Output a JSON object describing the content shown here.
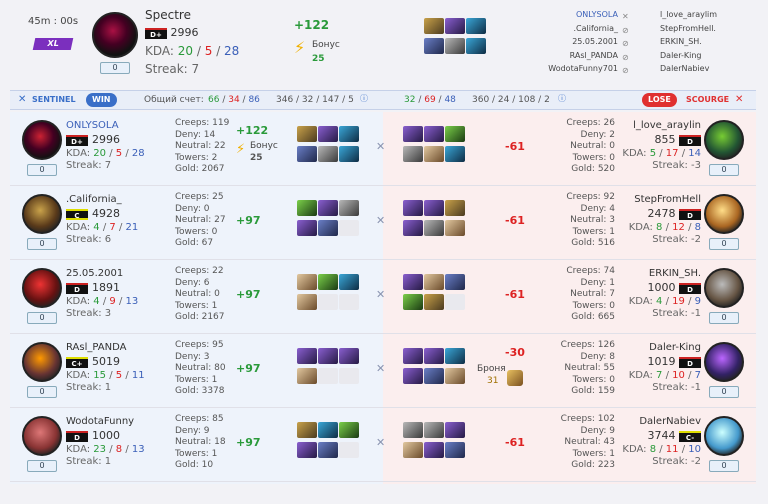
{
  "header": {
    "duration": "45m : 00s",
    "skill": "XL",
    "hero_level": "0",
    "hero_name": "Spectre",
    "rank": "D+",
    "mmr": "2996",
    "kda_label": "KDA:",
    "kda": [
      "20",
      "5",
      "28"
    ],
    "streak": "Streak: 7",
    "delta": "+122",
    "bonus_label": "Бонус",
    "bonus": "25",
    "mini_left": [
      ".California_",
      "25.05.2001",
      "RAsl_PANDA",
      "WodotaFunny701"
    ],
    "mini_left_top": "ONLYSOLA",
    "mini_right": [
      "l_love_araylim",
      "StepFromHell.",
      "ERKIN_SH.",
      "Daler-King",
      "DalerNabiev"
    ]
  },
  "bar": {
    "sentinel": "SENTINEL",
    "win": "WIN",
    "total_label": "Общий счет:",
    "left_kda": [
      "66",
      "34",
      "86"
    ],
    "left_stats": "346 / 32 / 147 / 5",
    "right_kda": [
      "32",
      "69",
      "48"
    ],
    "right_stats": "360 / 24 / 108 / 2",
    "lose": "LOSE",
    "scourge": "SCOURGE"
  },
  "left": [
    {
      "name": "ONLYSOLA",
      "rank": "D+",
      "mmr": "2996",
      "kda": [
        "20",
        "5",
        "28"
      ],
      "streak": "Streak: 7",
      "lvl": "0",
      "creeps": "Creeps: 119",
      "deny": "Deny: 14",
      "neutral": "Neutral: 22",
      "towers": "Towers: 2",
      "gold": "Gold: 2067",
      "delta": "+122",
      "bonus_label": "Бонус",
      "bonus": "25",
      "items": [
        "i1",
        "i6",
        "i3",
        "i2",
        "i5",
        "i3"
      ]
    },
    {
      "name": ".California_",
      "rank": "C",
      "mmr": "4928",
      "kda": [
        "4",
        "7",
        "21"
      ],
      "streak": "Streak: 6",
      "lvl": "0",
      "creeps": "Creeps: 25",
      "deny": "Deny: 0",
      "neutral": "Neutral: 27",
      "towers": "Towers: 0",
      "gold": "Gold: 67",
      "delta": "+97",
      "items": [
        "i4",
        "i6",
        "i5",
        "i6",
        "i2",
        "i0"
      ]
    },
    {
      "name": "25.05.2001",
      "rank": "D",
      "mmr": "1891",
      "kda": [
        "4",
        "9",
        "13"
      ],
      "streak": "Streak: 3",
      "lvl": "0",
      "creeps": "Creeps: 22",
      "deny": "Deny: 6",
      "neutral": "Neutral: 0",
      "towers": "Towers: 1",
      "gold": "Gold: 2167",
      "delta": "+97",
      "items": [
        "i7",
        "i4",
        "i3",
        "i7",
        "i0",
        "i0"
      ]
    },
    {
      "name": "RAsl_PANDA",
      "rank": "C+",
      "mmr": "5019",
      "kda": [
        "15",
        "5",
        "11"
      ],
      "streak": "Streak: 1",
      "lvl": "0",
      "creeps": "Creeps: 95",
      "deny": "Deny: 3",
      "neutral": "Neutral: 80",
      "towers": "Towers: 1",
      "gold": "Gold: 3378",
      "delta": "+97",
      "items": [
        "i6",
        "i6",
        "i6",
        "i7",
        "i0",
        "i0"
      ]
    },
    {
      "name": "WodotaFunny",
      "rank": "D",
      "mmr": "1000",
      "kda": [
        "23",
        "8",
        "13"
      ],
      "streak": "Streak: 1",
      "lvl": "0",
      "creeps": "Creeps: 85",
      "deny": "Deny: 9",
      "neutral": "Neutral: 18",
      "towers": "Towers: 1",
      "gold": "Gold: 10",
      "delta": "+97",
      "items": [
        "i1",
        "i3",
        "i4",
        "i6",
        "i2",
        "i0"
      ]
    }
  ],
  "right": [
    {
      "name": "l_love_araylin",
      "rank": "D",
      "mmr": "855",
      "kda": [
        "5",
        "17",
        "14"
      ],
      "streak": "Streak: -3",
      "lvl": "0",
      "creeps": "Creeps: 26",
      "deny": "Deny: 2",
      "neutral": "Neutral: 0",
      "towers": "Towers: 0",
      "gold": "Gold: 520",
      "delta": "-61",
      "items": [
        "i6",
        "i6",
        "i4",
        "i5",
        "i7",
        "i3"
      ]
    },
    {
      "name": "StepFromHell",
      "rank": "D",
      "mmr": "2478",
      "kda": [
        "8",
        "12",
        "8"
      ],
      "streak": "Streak: -2",
      "lvl": "0",
      "creeps": "Creeps: 92",
      "deny": "Deny: 4",
      "neutral": "Neutral: 3",
      "towers": "Towers: 1",
      "gold": "Gold: 516",
      "delta": "-61",
      "items": [
        "i6",
        "i6",
        "i1",
        "i6",
        "i5",
        "i7"
      ]
    },
    {
      "name": "ERKIN_SH.",
      "rank": "D",
      "mmr": "1000",
      "kda": [
        "4",
        "19",
        "9"
      ],
      "streak": "Streak: -1",
      "lvl": "0",
      "creeps": "Creeps: 74",
      "deny": "Deny: 1",
      "neutral": "Neutral: 7",
      "towers": "Towers: 0",
      "gold": "Gold: 665",
      "delta": "-61",
      "items": [
        "i6",
        "i7",
        "i2",
        "i4",
        "i1",
        "i0"
      ]
    },
    {
      "name": "Daler-King",
      "rank": "D",
      "mmr": "1019",
      "kda": [
        "7",
        "10",
        "7"
      ],
      "streak": "Streak: -1",
      "lvl": "0",
      "creeps": "Creeps: 126",
      "deny": "Deny: 8",
      "neutral": "Neutral: 55",
      "towers": "Towers: 0",
      "gold": "Gold: 159",
      "delta": "-30",
      "armor_label": "Броня",
      "armor": "31",
      "items": [
        "i6",
        "i6",
        "i3",
        "i6",
        "i2",
        "i7"
      ]
    },
    {
      "name": "DalerNabiev",
      "rank": "C-",
      "mmr": "3744",
      "kda": [
        "8",
        "11",
        "10"
      ],
      "streak": "Streak: -2",
      "lvl": "0",
      "creeps": "Creeps: 102",
      "deny": "Deny: 9",
      "neutral": "Neutral: 43",
      "towers": "Towers: 1",
      "gold": "Gold: 223",
      "delta": "-61",
      "items": [
        "i5",
        "i5",
        "i6",
        "i7",
        "i6",
        "i2"
      ]
    }
  ]
}
